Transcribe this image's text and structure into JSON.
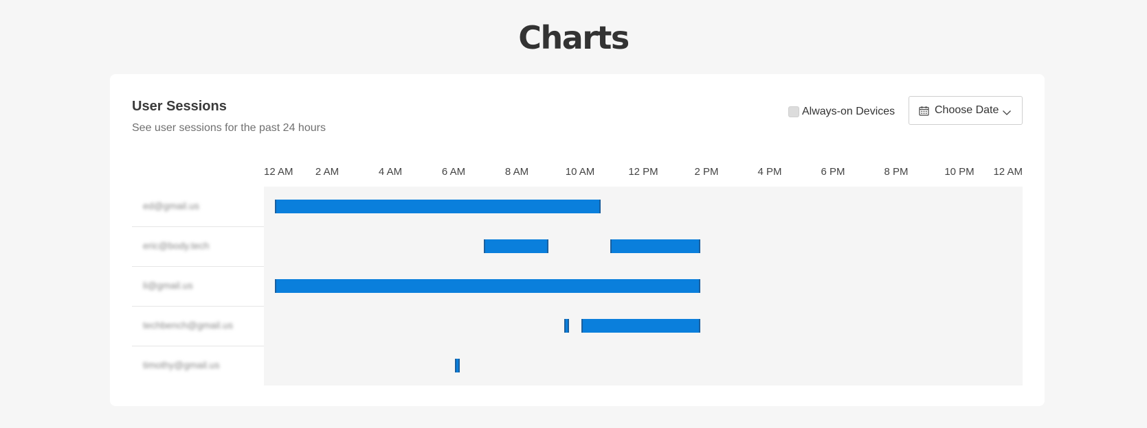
{
  "page": {
    "title": "Charts"
  },
  "card": {
    "title": "User Sessions",
    "subtitle": "See user sessions for the past 24 hours",
    "always_on_label": "Always-on Devices",
    "always_on_checked": false,
    "choose_date_label": "Choose Date",
    "accent_color": "#0a7fdc",
    "icons": {
      "date_icon": "calendar-icon",
      "dropdown_icon": "chevron-down-icon"
    }
  },
  "chart_data": {
    "type": "timeline",
    "x_range_hours": [
      0,
      24
    ],
    "tick_labels": [
      "12 AM",
      "2 AM",
      "4 AM",
      "6 AM",
      "8 AM",
      "10 AM",
      "12 PM",
      "2 PM",
      "4 PM",
      "6 PM",
      "8 PM",
      "10 PM",
      "12 AM"
    ],
    "rows": [
      {
        "user": "ed@gmail.us",
        "sessions": [
          {
            "start": 0.35,
            "end": 10.65
          }
        ]
      },
      {
        "user": "eric@body.tech",
        "sessions": [
          {
            "start": 6.95,
            "end": 9.0
          },
          {
            "start": 10.95,
            "end": 13.8
          }
        ]
      },
      {
        "user": "li@gmail.us",
        "sessions": [
          {
            "start": 0.35,
            "end": 13.8
          }
        ]
      },
      {
        "user": "techbench@gmail.us",
        "sessions": [
          {
            "start": 9.5,
            "end": 9.65
          },
          {
            "start": 10.05,
            "end": 13.8
          }
        ]
      },
      {
        "user": "timothy@gmail.us",
        "sessions": [
          {
            "start": 6.05,
            "end": 6.2
          }
        ]
      }
    ]
  }
}
